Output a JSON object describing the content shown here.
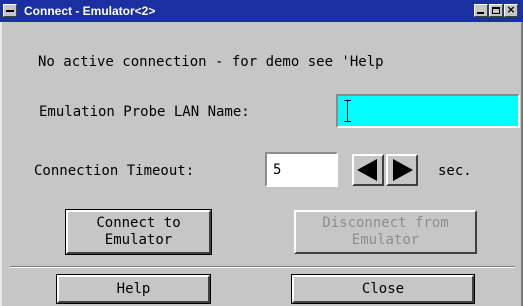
{
  "window": {
    "title": "Connect - Emulator<2>"
  },
  "message": "No active connection - for demo see 'Help",
  "lan_name": {
    "label": "Emulation Probe LAN Name:",
    "value": "",
    "background": "#00ffff"
  },
  "timeout": {
    "label": "Connection Timeout:",
    "value": "5",
    "unit": "sec.",
    "decrease_icon": "left-arrow-icon",
    "increase_icon": "right-arrow-icon"
  },
  "buttons": {
    "connect": "Connect to\nEmulator",
    "disconnect": "Disconnect from\nEmulator",
    "help": "Help",
    "close": "Close"
  },
  "colors": {
    "titlebar": "#1a2fa0",
    "window_bg": "#c6c6c6",
    "disabled_text": "#8e8e8e"
  }
}
